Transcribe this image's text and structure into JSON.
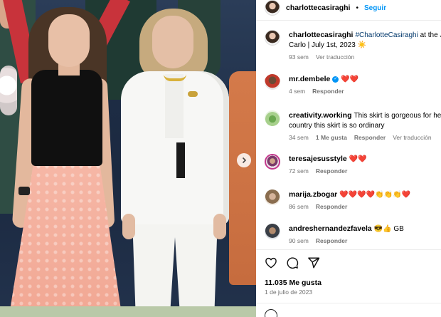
{
  "post": {
    "author": "charlottecasiraghi",
    "follow_label": "Seguir",
    "separator": "•",
    "caption_user": "charlottecasiraghi",
    "caption_hashtag": "#CharlotteCasiraghi",
    "caption_text": " at the J",
    "caption_line2": "Carlo | July 1st, 2023 ☀️",
    "caption_time": "93 sem",
    "caption_translate": "Ver traducción"
  },
  "comments": [
    {
      "user": "mr.dembele",
      "verified": true,
      "text": "❤️❤️",
      "time": "4 sem",
      "likes": "",
      "reply": "Responder",
      "translate": ""
    },
    {
      "user": "creativity.working",
      "verified": false,
      "text": "This skirt is gorgeous for he",
      "line2": "country this skirt is so ordinary",
      "time": "34 sem",
      "likes": "1 Me gusta",
      "reply": "Responder",
      "translate": "Ver traducción"
    },
    {
      "user": "teresajesusstyle",
      "verified": false,
      "text": "❤️❤️",
      "time": "72 sem",
      "likes": "",
      "reply": "Responder",
      "translate": ""
    },
    {
      "user": "marija.zbogar",
      "verified": false,
      "text": "❤️❤️❤️❤️👏👏👏❤️",
      "time": "86 sem",
      "likes": "",
      "reply": "Responder",
      "translate": ""
    },
    {
      "user": "andreshernandezfavela",
      "verified": false,
      "text": "😎👍 GB",
      "time": "90 sem",
      "likes": "",
      "reply": "Responder",
      "translate": ""
    }
  ],
  "footer": {
    "likes": "11.035 Me gusta",
    "date": "1 de julio de 2023"
  },
  "icons": {
    "heart": "heart-icon",
    "comment": "comment-icon",
    "share": "share-icon",
    "carousel_next": "chevron-right-icon"
  },
  "colors": {
    "link": "#0095f6",
    "hashtag": "#00376b",
    "secondary_text": "#737373"
  }
}
